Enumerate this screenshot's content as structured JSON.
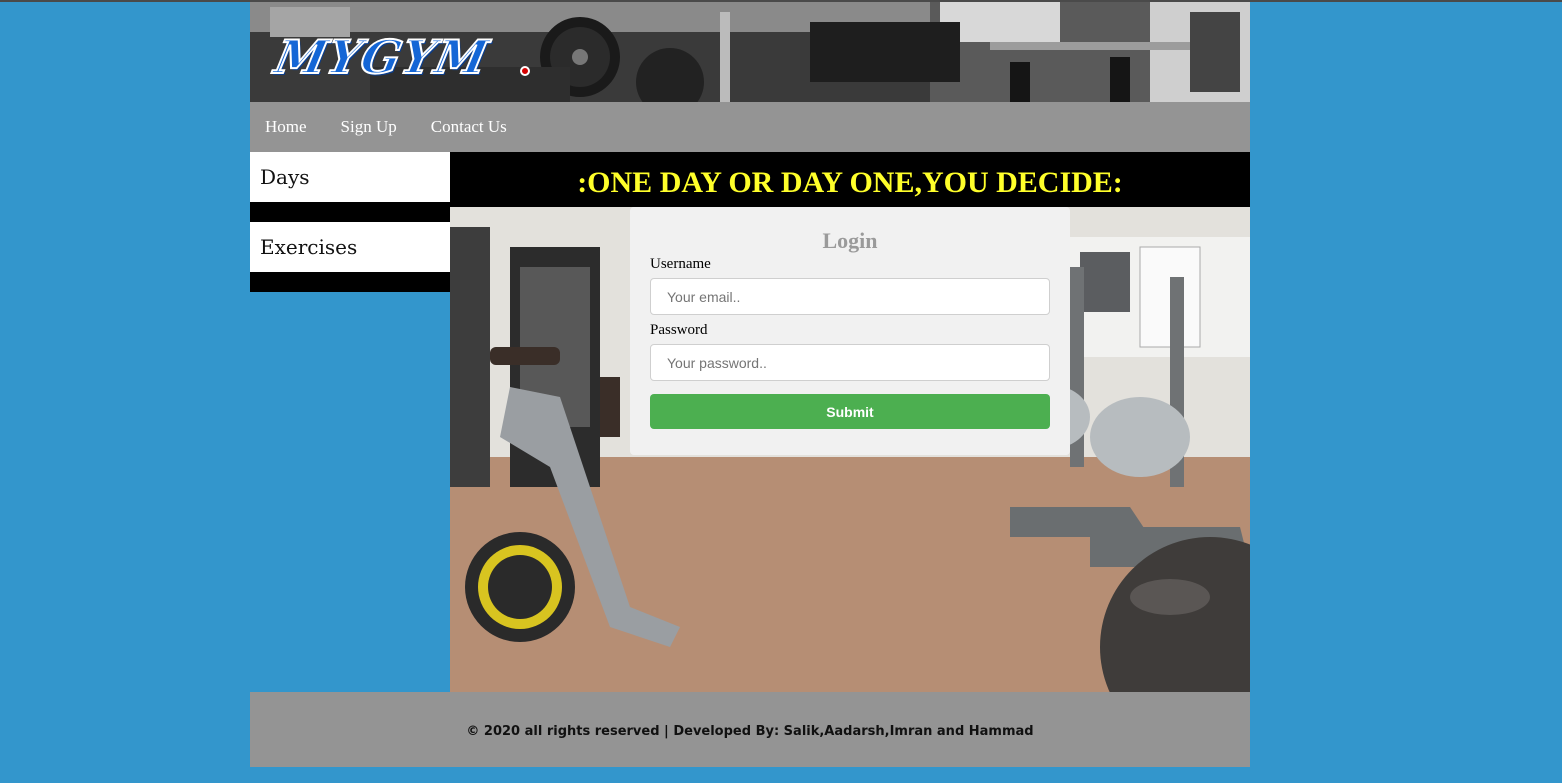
{
  "header": {
    "logo_text": "MYGYM"
  },
  "nav": {
    "items": [
      "Home",
      "Sign Up",
      "Contact Us"
    ]
  },
  "sidebar": {
    "items": [
      "Days",
      "Exercises"
    ]
  },
  "main": {
    "tagline": ":ONE DAY OR DAY ONE,YOU DECIDE:"
  },
  "login": {
    "title": "Login",
    "username_label": "Username",
    "username_placeholder": "Your email..",
    "password_label": "Password",
    "password_placeholder": "Your password..",
    "submit_label": "Submit"
  },
  "footer": {
    "text": "© 2020 all rights reserved | Developed By: Salik,Aadarsh,Imran and Hammad"
  },
  "colors": {
    "page_background": "#3396cc",
    "nav_background": "#949494",
    "tagline_text": "#ffff2a",
    "submit_button": "#4caf50",
    "logo_blue": "#1466d6"
  }
}
